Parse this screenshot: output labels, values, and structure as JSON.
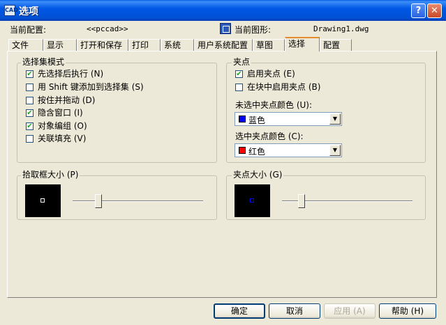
{
  "window": {
    "title": "选项",
    "help_label": "?",
    "close_label": "✕",
    "icon_text": "CAD"
  },
  "header": {
    "profile_label": "当前配置:",
    "profile_value": "<<pccad>>",
    "drawing_label": "当前图形:",
    "drawing_value": "Drawing1.dwg"
  },
  "tabs": [
    {
      "label": "文件"
    },
    {
      "label": "显示"
    },
    {
      "label": "打开和保存"
    },
    {
      "label": "打印"
    },
    {
      "label": "系统"
    },
    {
      "label": "用户系统配置"
    },
    {
      "label": "草图"
    },
    {
      "label": "选择",
      "active": true
    },
    {
      "label": "配置"
    }
  ],
  "selection_modes": {
    "title": "选择集模式",
    "items": [
      {
        "label": "先选择后执行 (N)",
        "checked": "✔"
      },
      {
        "label": "用 Shift 键添加到选择集 (S)",
        "checked": ""
      },
      {
        "label": "按住并拖动 (D)",
        "checked": ""
      },
      {
        "label": "隐含窗口 (I)",
        "checked": "✔"
      },
      {
        "label": "对象编组 (O)",
        "checked": "✔"
      },
      {
        "label": "关联填充 (V)",
        "checked": ""
      }
    ]
  },
  "grips": {
    "title": "夹点",
    "enable": {
      "label": "启用夹点 (E)",
      "checked": "✔"
    },
    "in_blocks": {
      "label": "在块中启用夹点 (B)",
      "checked": ""
    },
    "unselected_label": "未选中夹点颜色 (U):",
    "unselected_value": "蓝色",
    "unselected_color": "#0000ff",
    "selected_label": "选中夹点颜色 (C):",
    "selected_value": "红色",
    "selected_color": "#ff0000"
  },
  "pickbox": {
    "title": "拾取框大小 (P)",
    "slider_value": 0.18
  },
  "gripsize": {
    "title": "夹点大小 (G)",
    "slider_value": 0.13
  },
  "buttons": {
    "ok": "确定",
    "cancel": "取消",
    "apply": "应用 (A)",
    "help": "帮助 (H)"
  }
}
